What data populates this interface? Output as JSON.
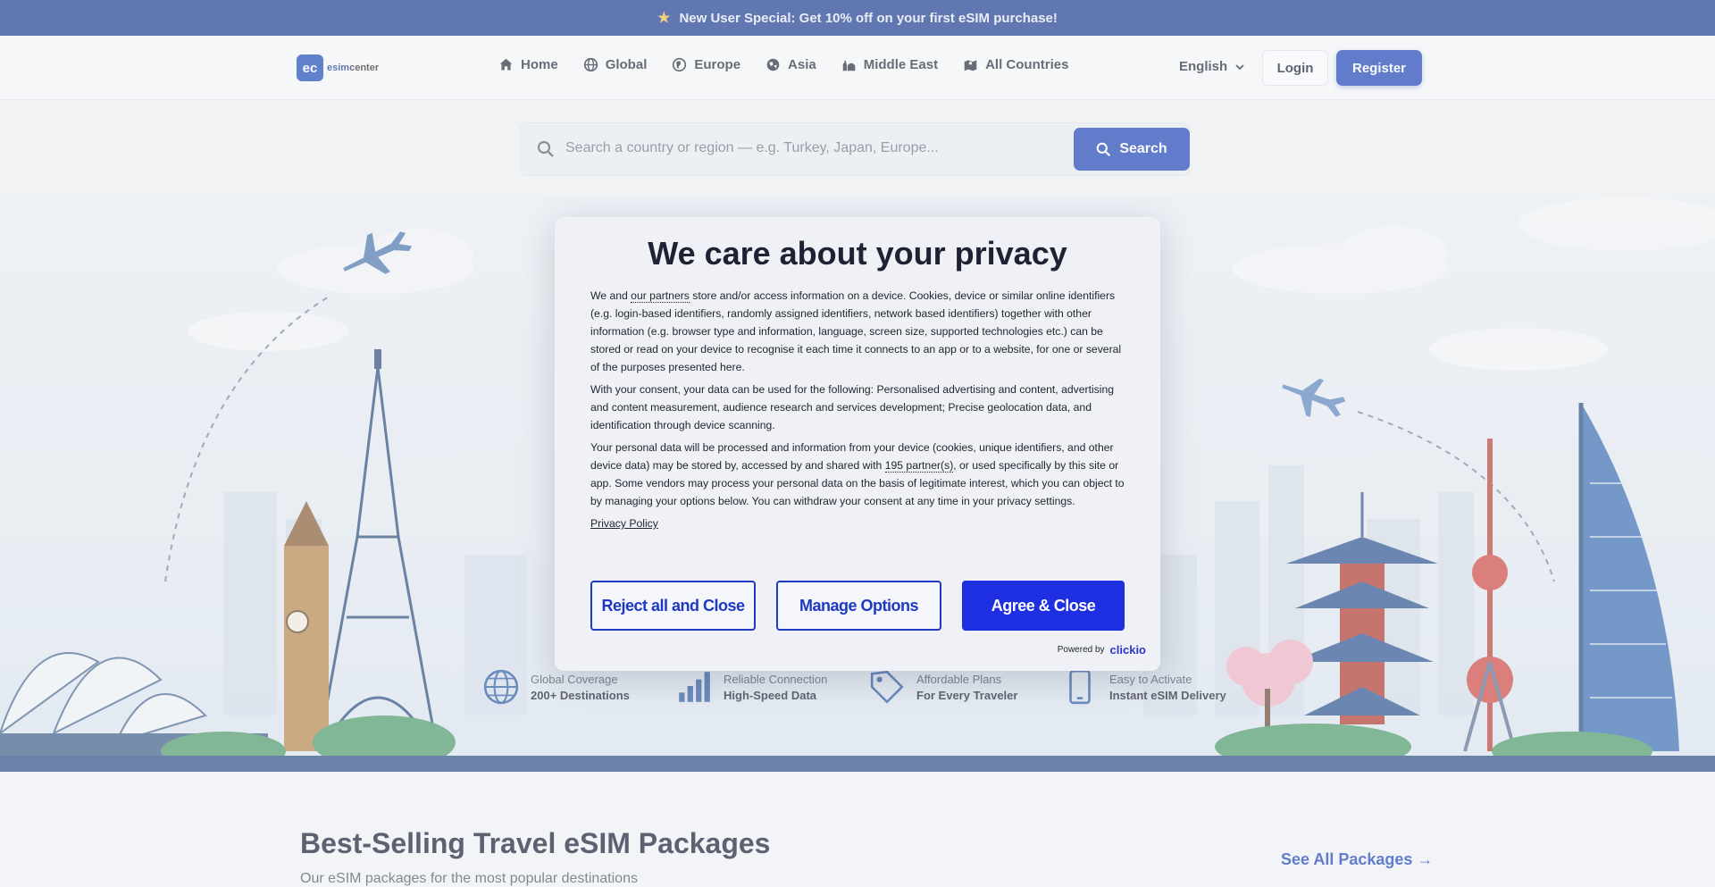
{
  "promo": {
    "icon": "star-icon",
    "text": "New User Special: Get 10% off on your first eSIM purchase!"
  },
  "header": {
    "logo_mark": "ec",
    "logo_word_1": "esim",
    "logo_word_2": "center",
    "nav": [
      {
        "label": "Home",
        "icon": "home-icon"
      },
      {
        "label": "Global",
        "icon": "globe-icon"
      },
      {
        "label": "Europe",
        "icon": "europe-icon"
      },
      {
        "label": "Asia",
        "icon": "asia-icon"
      },
      {
        "label": "Middle East",
        "icon": "mosque-icon"
      },
      {
        "label": "All Countries",
        "icon": "map-icon"
      }
    ],
    "language": "English",
    "login_label": "Login",
    "register_label": "Register"
  },
  "search": {
    "placeholder": "Search a country or region — e.g. Turkey, Japan, Europe...",
    "button_label": "Search"
  },
  "features": [
    {
      "title": "Global Coverage",
      "subtitle": "200+ Destinations",
      "icon": "globe-icon"
    },
    {
      "title": "Reliable Connection",
      "subtitle": "High-Speed Data",
      "icon": "signal-bars-icon"
    },
    {
      "title": "Affordable Plans",
      "subtitle": "For Every Traveler",
      "icon": "price-tag-icon"
    },
    {
      "title": "Easy to Activate",
      "subtitle": "Instant eSIM Delivery",
      "icon": "phone-icon"
    }
  ],
  "section": {
    "title": "Best-Selling Travel eSIM Packages",
    "subtitle": "Our eSIM packages for the most popular destinations",
    "see_all": "See All Packages →"
  },
  "consent": {
    "title": "We care about your privacy",
    "p1_a": "We and ",
    "p1_link": "our partners",
    "p1_b": " store and/or access information on a device. Cookies, device or similar online identifiers (e.g. login-based identifiers, randomly assigned identifiers, network based identifiers) together with other information (e.g. browser type and information, language, screen size, supported technologies etc.) can be stored or read on your device to recognise it each time it connects to an app or to a website, for one or several of the purposes presented here.",
    "p2": "With your consent, your data can be used for the following: Personalised advertising and content, advertising and content measurement, audience research and services development; Precise geolocation data, and identification through device scanning.",
    "p3_a": "Your personal data will be processed and information from your device (cookies, unique identifiers, and other device data) may be stored by, accessed by and shared with ",
    "p3_link": "195 partner(s)",
    "p3_b": ", or used specifically by this site or app. Some vendors may process your personal data on the basis of legitimate interest, which you can object to by managing your options below. You can withdraw your consent at any time in your privacy settings.",
    "privacy_policy": "Privacy Policy",
    "reject_label": "Reject all and Close",
    "manage_label": "Manage Options",
    "agree_label": "Agree & Close",
    "powered_by": "Powered by",
    "powered_brand": "clickio"
  }
}
